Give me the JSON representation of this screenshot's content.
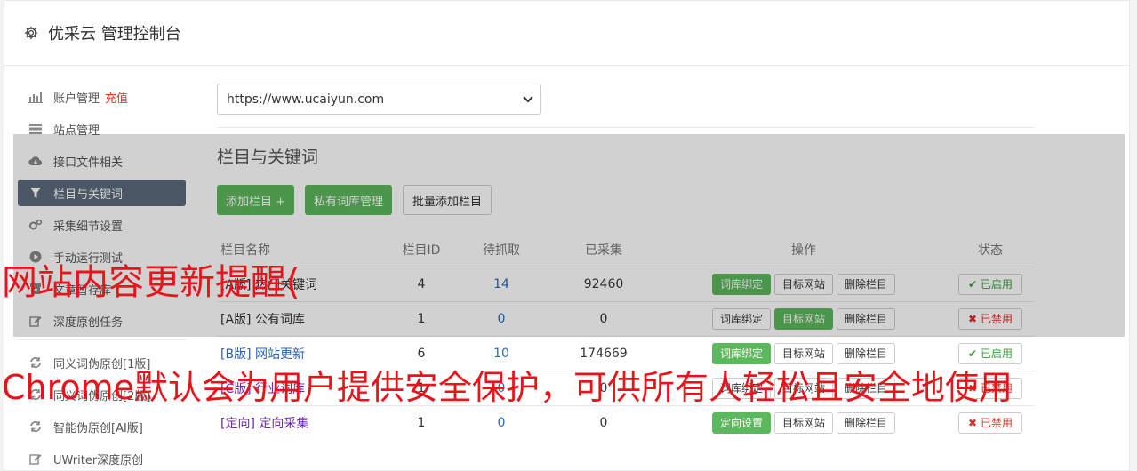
{
  "header": {
    "title": "优采云 管理控制台",
    "icon": "gear-icon"
  },
  "sidebar": {
    "items": [
      {
        "label": "账户管理",
        "extra": "充值",
        "icon": "bar-chart-icon"
      },
      {
        "label": "站点管理",
        "icon": "server-icon"
      },
      {
        "label": "接口文件相关",
        "icon": "cloud-download-icon"
      },
      {
        "label": "栏目与关键词",
        "icon": "filter-icon",
        "active": true
      },
      {
        "label": "采集细节设置",
        "icon": "cogs-icon"
      },
      {
        "label": "手动运行测试",
        "icon": "play-icon"
      },
      {
        "label": "文章暂存库",
        "icon": "archive-icon"
      },
      {
        "label": "深度原创任务",
        "icon": "edit-icon"
      }
    ],
    "items2": [
      {
        "label": "同义词伪原创[1版]",
        "icon": "refresh-icon"
      },
      {
        "label": "同义词伪原创[2版]",
        "icon": "refresh-icon"
      },
      {
        "label": "智能伪原创[AI版]",
        "icon": "refresh-icon"
      },
      {
        "label": "UWriter深度原创",
        "icon": "edit-icon"
      }
    ]
  },
  "main": {
    "site_select": "https://www.ucaiyun.com",
    "section_title": "栏目与关键词",
    "buttons": {
      "add": "添加栏目 +",
      "private": "私有词库管理",
      "batch": "批量添加栏目"
    },
    "table": {
      "headers": {
        "name": "栏目名称",
        "id": "栏目ID",
        "pending": "待抓取",
        "done": "已采集",
        "ops": "操作",
        "status": "状态"
      },
      "rows": [
        {
          "name": "[A版] 热门关键词",
          "id": "4",
          "pending": "14",
          "done": "92460",
          "op1": "词库绑定",
          "op2": "目标网站",
          "op3": "删除栏目",
          "status": "已启用"
        },
        {
          "name": "[A版] 公有词库",
          "id": "1",
          "pending": "0",
          "done": "0",
          "op1": "词库绑定",
          "op2": "目标网站",
          "op3": "删除栏目",
          "status": "已禁用"
        },
        {
          "name": "[B版] 网站更新",
          "id": "6",
          "pending": "10",
          "done": "174669",
          "op1": "词库绑定",
          "op2": "目标网站",
          "op3": "删除栏目",
          "status": "已启用"
        },
        {
          "name": "[C版] 行业词库",
          "id": "1",
          "pending": "0",
          "done": "0",
          "op1": "词库绑定",
          "op2": "目标网站",
          "op3": "删除栏目",
          "status": "已禁用"
        },
        {
          "name": "[定向] 定向采集",
          "id": "1",
          "pending": "0",
          "done": "0",
          "op1": "定向设置",
          "op2": "目标网站",
          "op3": "删除栏目",
          "status": "已禁用"
        }
      ]
    }
  },
  "overlay": {
    "line1": "网站内容更新提醒(",
    "line2": "Chrome默认会为用户提供安全保护，可供所有人轻松且安全地使用"
  }
}
